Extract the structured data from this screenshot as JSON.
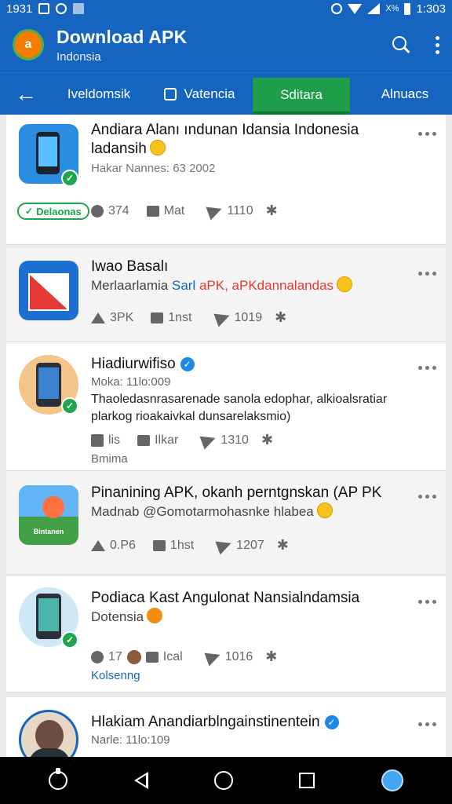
{
  "status_bar": {
    "time": "1931",
    "clock": "1:303",
    "battery_text": "X%"
  },
  "app_bar": {
    "title": "Download APK",
    "subtitle": "Indonsia",
    "logo_letter": "a"
  },
  "tabs": [
    {
      "label": "Iveldomsik"
    },
    {
      "label": "Vatencia"
    },
    {
      "label": "Sditara",
      "active": true
    },
    {
      "label": "Alnuacs"
    }
  ],
  "posts": [
    {
      "title": "Andiara Alanı ındunan Idansia Indonesia ladansih",
      "meta": "Hakar Nannes: 63 2002",
      "badge": "Delaonas",
      "stats": {
        "comments": "374",
        "likes": "Mat",
        "shares": "1110"
      }
    },
    {
      "title": "Iwao Basalı",
      "line_prefix": "Merlaarlamia",
      "line_blue": "Sarl",
      "line_red": "aPK, aPKdannalandas",
      "stats": {
        "views": "3PK",
        "likes": "1nst",
        "shares": "1019"
      }
    },
    {
      "title": "Hiadiurwifiso",
      "meta": "Moka: 11lo:009",
      "body": "Thaoledasnrasarenade sanola edophar, alkioalsratiar plarkog rioakaivkal dunsarelaksmio)",
      "stats": {
        "saves": "lis",
        "likes": "Ilkar",
        "shares": "1310"
      },
      "tag": "Bmima"
    },
    {
      "title": "Pinanining APK, okanh perntgnskan (AP PK",
      "line": "Madnab @Gomotarmohasnke hlabea",
      "stats": {
        "views": "0.P6",
        "likes": "1hst",
        "shares": "1207"
      },
      "thumb_label": "Bintanen"
    },
    {
      "title": "Podiaca Kast Angulonat Nansialndamsia",
      "line": "Dotensia",
      "stats": {
        "comments": "17",
        "likes": "Ical",
        "shares": "1016"
      },
      "tag": "Kolsenng"
    },
    {
      "title": "Hlakiam Anandiarblngainstinentein",
      "meta": "Narle: 11lo:109"
    }
  ],
  "colors": {
    "primary": "#1565c0",
    "active_tab": "#1e9e4a",
    "verified": "#1fa54a"
  }
}
